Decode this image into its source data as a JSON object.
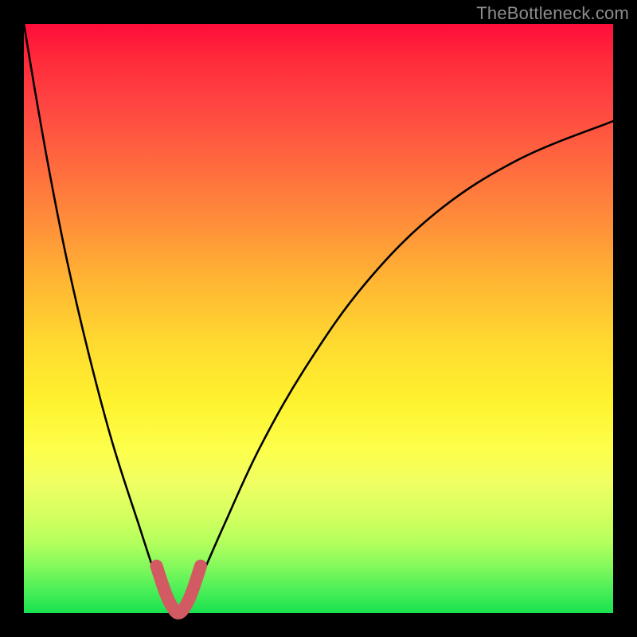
{
  "watermark": "TheBottleneck.com",
  "colors": {
    "curve": "#000000",
    "highlight": "#d25a62",
    "background_frame": "#000000"
  },
  "chart_data": {
    "type": "line",
    "title": "",
    "xlabel": "",
    "ylabel": "",
    "x_range_fraction": [
      0,
      1
    ],
    "y_range_fraction": [
      0,
      1
    ],
    "notch_x_fraction": 0.262,
    "series": [
      {
        "name": "bottleneck-curve",
        "description": "V-shaped curve with near-zero minimum around x≈0.26; left arm rises steeply to top-left, right arm rises with decreasing slope to upper-right.",
        "x_fraction": [
          0.0,
          0.02,
          0.045,
          0.075,
          0.11,
          0.15,
          0.195,
          0.225,
          0.245,
          0.255,
          0.262,
          0.269,
          0.28,
          0.3,
          0.34,
          0.4,
          0.48,
          0.58,
          0.7,
          0.84,
          1.0
        ],
        "y_fraction": [
          1.0,
          0.88,
          0.74,
          0.59,
          0.44,
          0.29,
          0.15,
          0.06,
          0.02,
          0.006,
          0.0,
          0.006,
          0.022,
          0.06,
          0.15,
          0.28,
          0.42,
          0.56,
          0.68,
          0.77,
          0.835
        ]
      },
      {
        "name": "notch-highlight",
        "description": "Thick rounded U-shaped overlay marking the bottom of the notch (the optimal/balanced zone).",
        "x_fraction": [
          0.225,
          0.24,
          0.252,
          0.262,
          0.273,
          0.285,
          0.3
        ],
        "y_fraction": [
          0.08,
          0.035,
          0.01,
          0.0,
          0.01,
          0.035,
          0.08
        ]
      }
    ]
  }
}
